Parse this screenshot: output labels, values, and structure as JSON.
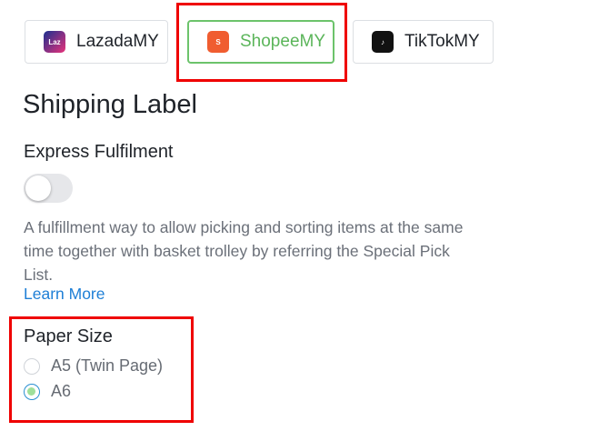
{
  "tabs": [
    {
      "label": "LazadaMY",
      "logo": "lazada-logo",
      "logo_text": "Laz"
    },
    {
      "label": "ShopeeMY",
      "logo": "shopee-logo",
      "logo_text": "S",
      "selected": true
    },
    {
      "label": "TikTokMY",
      "logo": "tiktok-logo",
      "logo_text": "♪"
    }
  ],
  "page": {
    "title": "Shipping Label"
  },
  "express": {
    "title": "Express Fulfilment",
    "enabled": false,
    "description": "A fulfillment way to allow picking and sorting items at the same time together with basket trolley by referring the Special Pick List.",
    "link": "Learn More"
  },
  "paper_size": {
    "title": "Paper Size",
    "options": [
      {
        "label": "A5 (Twin Page)",
        "selected": false
      },
      {
        "label": "A6",
        "selected": true
      }
    ]
  },
  "colors": {
    "highlight": "#ef0000",
    "selected_tab": "#6cc36b",
    "link": "#1e7fd6"
  }
}
